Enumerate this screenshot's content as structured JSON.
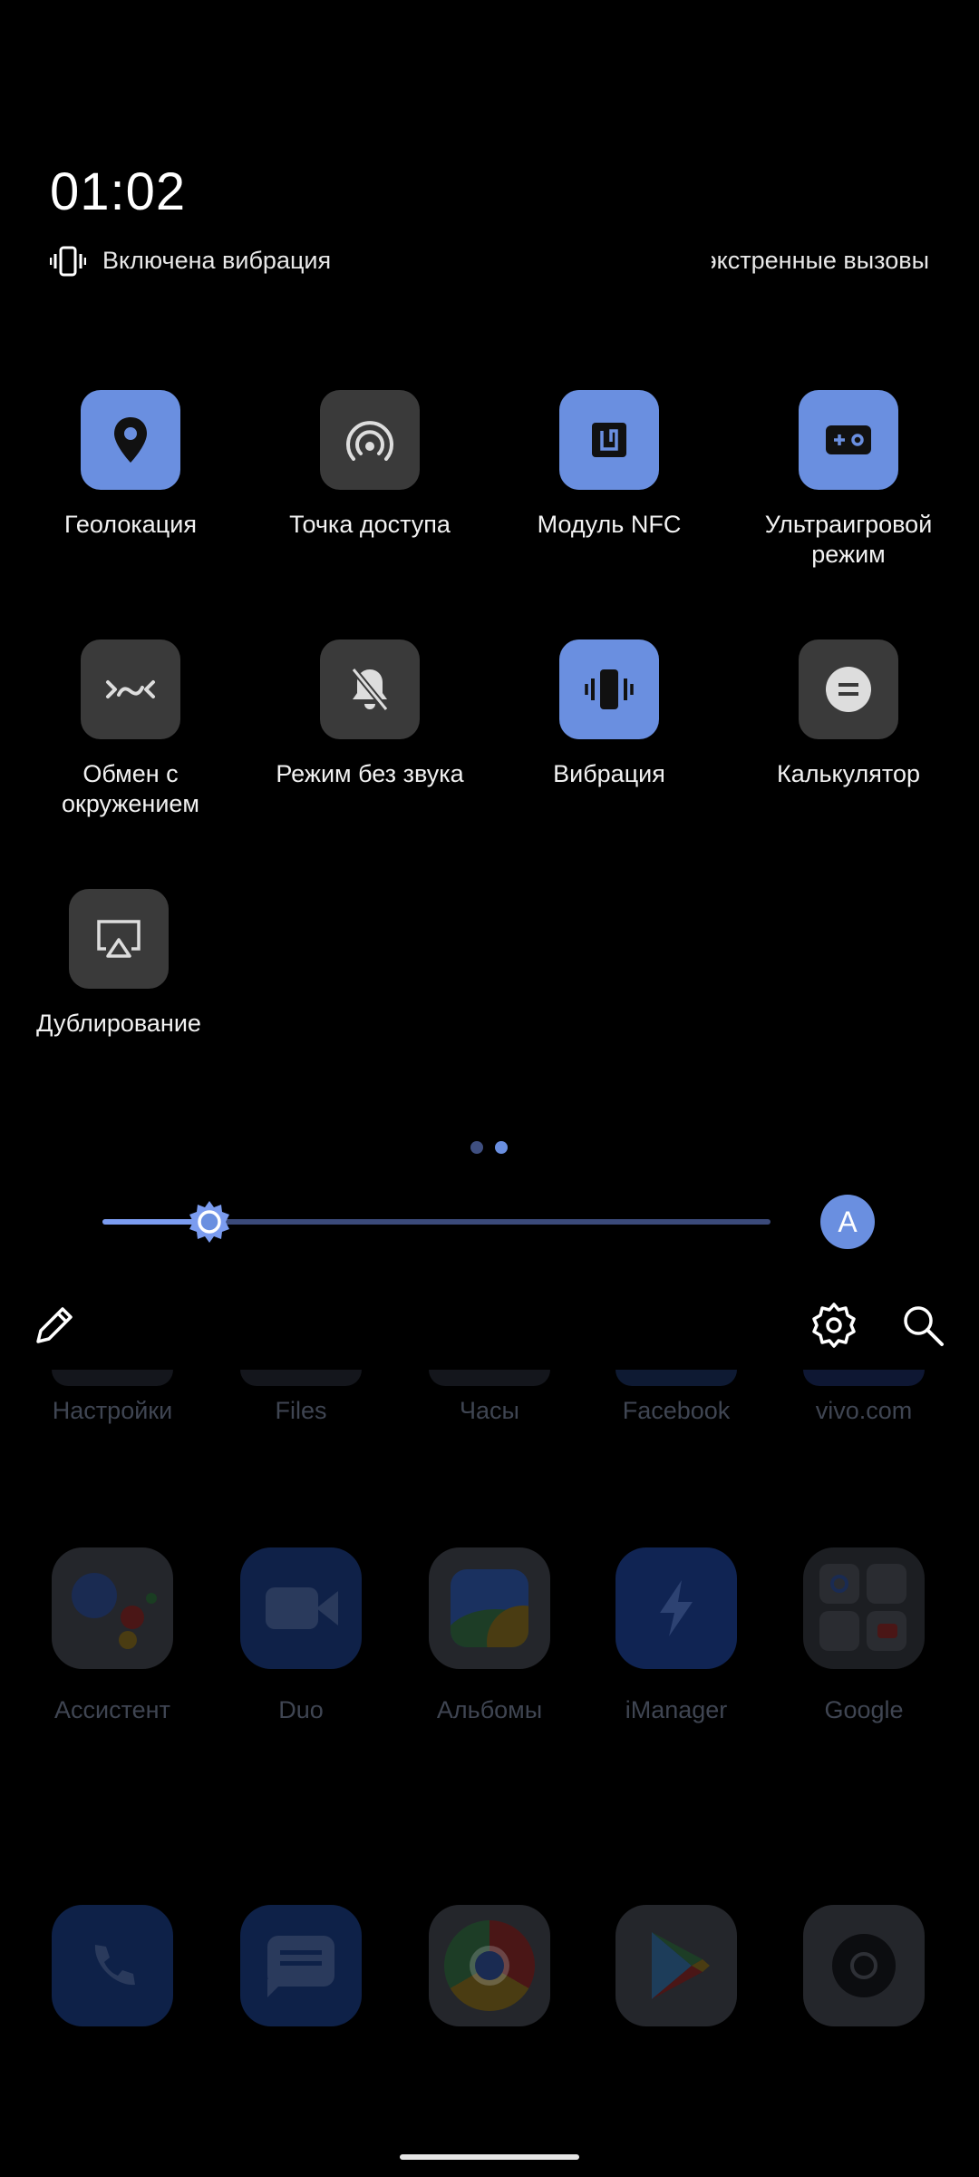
{
  "status": {
    "time": "01:02",
    "vibration_label": "Включена вибрация",
    "dnd_label": "Только экстренные вызовы"
  },
  "tiles": [
    {
      "label": "Геолокация",
      "state": "on",
      "icon": "location-pin-icon"
    },
    {
      "label": "Точка доступа",
      "state": "off",
      "icon": "hotspot-icon"
    },
    {
      "label": "Модуль NFC",
      "state": "on",
      "icon": "nfc-icon"
    },
    {
      "label": "Ультраигровой режим",
      "state": "on",
      "icon": "gamepad-icon"
    },
    {
      "label": "Обмен с окружением",
      "state": "off",
      "icon": "nearby-share-icon"
    },
    {
      "label": "Режим без звука",
      "state": "off",
      "icon": "bell-off-icon"
    },
    {
      "label": "Вибрация",
      "state": "on",
      "icon": "vibration-icon"
    },
    {
      "label": "Калькулятор",
      "state": "off",
      "icon": "calculator-icon"
    },
    {
      "label": "Дублирование",
      "state": "off",
      "icon": "screen-mirror-icon"
    }
  ],
  "pager": {
    "pages": 2,
    "current": 2
  },
  "brightness": {
    "level": 0.16,
    "auto_label": "A"
  },
  "controls": {
    "edit_icon": "pencil-icon",
    "settings_icon": "gear-icon",
    "search_icon": "search-icon"
  },
  "home": {
    "row0": [
      "Настройки",
      "Files",
      "Часы",
      "Facebook",
      "vivo.com"
    ],
    "row1": [
      "Ассистент",
      "Duo",
      "Альбомы",
      "iManager",
      "Google"
    ],
    "dock": [
      "phone-icon",
      "messages-icon",
      "chrome-icon",
      "play-store-icon",
      "camera-icon"
    ]
  },
  "colors": {
    "accent": "#6a8fe0",
    "tile_off": "#3a3a3a",
    "background": "#000000"
  }
}
